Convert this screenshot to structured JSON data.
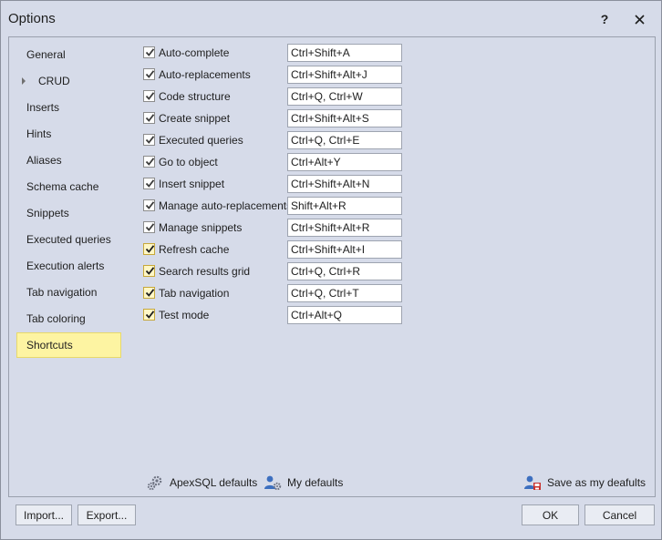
{
  "window": {
    "title": "Options",
    "help_label": "?"
  },
  "nav": {
    "items": [
      {
        "label": "General",
        "name": "nav-item-general"
      },
      {
        "label": "CRUD",
        "name": "nav-item-crud"
      },
      {
        "label": "Inserts",
        "name": "nav-item-inserts"
      },
      {
        "label": "Hints",
        "name": "nav-item-hints"
      },
      {
        "label": "Aliases",
        "name": "nav-item-aliases"
      },
      {
        "label": "Schema cache",
        "name": "nav-item-schema-cache"
      },
      {
        "label": "Snippets",
        "name": "nav-item-snippets"
      },
      {
        "label": "Executed queries",
        "name": "nav-item-executed-queries"
      },
      {
        "label": "Execution alerts",
        "name": "nav-item-execution-alerts"
      },
      {
        "label": "Tab navigation",
        "name": "nav-item-tab-navigation"
      },
      {
        "label": "Tab coloring",
        "name": "nav-item-tab-coloring"
      },
      {
        "label": "Shortcuts",
        "name": "nav-item-shortcuts"
      }
    ],
    "selected": "Shortcuts",
    "expandable": "CRUD"
  },
  "shortcuts": [
    {
      "label": "Auto-complete",
      "shortcut": "Ctrl+Shift+A",
      "checked": true,
      "style": "gray"
    },
    {
      "label": "Auto-replacements",
      "shortcut": "Ctrl+Shift+Alt+J",
      "checked": true,
      "style": "gray"
    },
    {
      "label": "Code structure",
      "shortcut": "Ctrl+Q, Ctrl+W",
      "checked": true,
      "style": "gray"
    },
    {
      "label": "Create snippet",
      "shortcut": "Ctrl+Shift+Alt+S",
      "checked": true,
      "style": "gray"
    },
    {
      "label": "Executed queries",
      "shortcut": "Ctrl+Q, Ctrl+E",
      "checked": true,
      "style": "gray"
    },
    {
      "label": "Go to object",
      "shortcut": "Ctrl+Alt+Y",
      "checked": true,
      "style": "gray"
    },
    {
      "label": "Insert snippet",
      "shortcut": "Ctrl+Shift+Alt+N",
      "checked": true,
      "style": "gray"
    },
    {
      "label": "Manage auto-replacements",
      "shortcut": "Shift+Alt+R",
      "checked": true,
      "style": "gray"
    },
    {
      "label": "Manage snippets",
      "shortcut": "Ctrl+Shift+Alt+R",
      "checked": true,
      "style": "gray"
    },
    {
      "label": "Refresh cache",
      "shortcut": "Ctrl+Shift+Alt+I",
      "checked": true,
      "style": "yellow"
    },
    {
      "label": "Search results grid",
      "shortcut": "Ctrl+Q, Ctrl+R",
      "checked": true,
      "style": "yellow"
    },
    {
      "label": "Tab navigation",
      "shortcut": "Ctrl+Q, Ctrl+T",
      "checked": true,
      "style": "yellow"
    },
    {
      "label": "Test mode",
      "shortcut": "Ctrl+Alt+Q",
      "checked": true,
      "style": "yellow"
    }
  ],
  "defaults": {
    "apexsql_label": "ApexSQL defaults",
    "my_label": "My defaults",
    "save_label": "Save as my deafults"
  },
  "buttons": {
    "import_label": "Import...",
    "export_label": "Export...",
    "ok_label": "OK",
    "cancel_label": "Cancel"
  },
  "colors": {
    "window_bg": "#d6dbe9",
    "selected_bg": "#fdf4a2",
    "checkbox_yellow": "#fff7c6"
  },
  "icons": {
    "apexsql_defaults": "gear-icon",
    "my_defaults": "user-gear-icon",
    "save_defaults": "user-save-icon",
    "expand": "caret-right-icon",
    "close": "close-icon"
  }
}
